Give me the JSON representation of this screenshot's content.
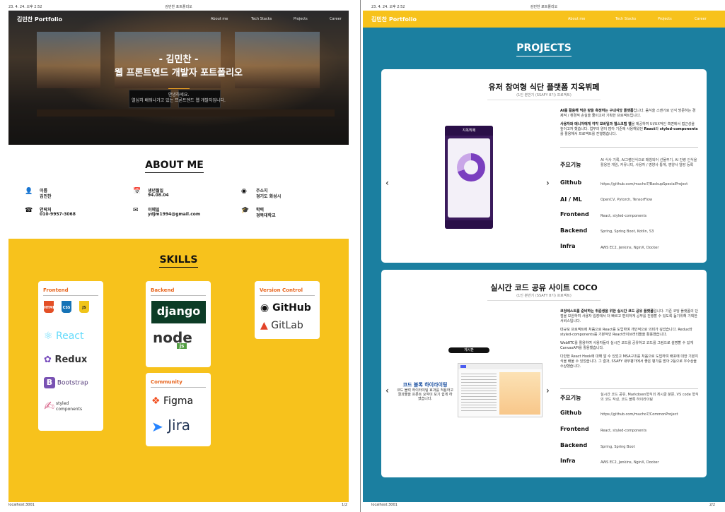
{
  "print": {
    "date": "23. 4. 24. 오후 2:52",
    "doc_title": "김민찬 포트폴리오",
    "url": "localhost:3001",
    "page1": "1/2",
    "page2": "2/2"
  },
  "nav": {
    "brand": "김민찬 Portfolio",
    "items": [
      "About me",
      "Tech Stacks",
      "Projects",
      "Career"
    ]
  },
  "hero": {
    "title_line1": "- 김민찬 -",
    "title_line2": "웹 프론트엔드 개발자 포트폴리오",
    "sub_line1": "안녕하세요.",
    "sub_line2": "열심히 배워나가고 있는 프론트엔드 웹 개발자입니다."
  },
  "about": {
    "title": "ABOUT ME",
    "items": [
      {
        "icon": "person-icon",
        "label": "이름",
        "value": "김민찬"
      },
      {
        "icon": "calendar-icon",
        "label": "생년월일",
        "value": "94.08.04"
      },
      {
        "icon": "location-icon",
        "label": "주소지",
        "value": "경기도 화성시"
      },
      {
        "icon": "phone-icon",
        "label": "연락처",
        "value": "010-9957-3068"
      },
      {
        "icon": "mail-icon",
        "label": "이메일",
        "value": "ydjm1994@gmail.com"
      },
      {
        "icon": "graduation-icon",
        "label": "학력",
        "value": "경북대학교"
      }
    ]
  },
  "skills": {
    "title": "SKILLS",
    "frontend": {
      "title": "Frontend",
      "logos": [
        "HTML",
        "CSS",
        "JS",
        "React",
        "Redux",
        "Bootstrap",
        "styled",
        "components"
      ]
    },
    "backend": {
      "title": "Backend",
      "logos": [
        "django",
        "node",
        "js"
      ]
    },
    "vcs": {
      "title": "Version Control",
      "logos": [
        "GitHub",
        "GitLab"
      ]
    },
    "community": {
      "title": "Community",
      "logos": [
        "Figma",
        "Jira"
      ]
    }
  },
  "projects": {
    "title": "PROJECTS",
    "p1": {
      "title": "유저 참여형 식단 플랫폼 지옥뷔페",
      "date": "(1인 분반기 (SSAFY 8기) 프로젝트)",
      "app_name": "지옥뷔페",
      "desc1_bold": "AI를 활용해 먹은 량을 측정하는 구내식당 플랫폼",
      "desc1": "입니다. 음식을 스캔기로 인식 방문하는 경제적 / 환경적 손실을 줄이고자 기획한 프로젝트입니다.",
      "desc2_bold": "사용자와 매니저에게 각각 모바일과 웹스크랩 웹",
      "desc2": "을 제공하여 UI/UX적인 측면에서 접근성을 높이고자 했습니다. 업무의 양이 많아 기준에 사용해왔던 ",
      "desc2_bold2": "React",
      "desc2b": "와 ",
      "desc2_bold3": "styled-components",
      "desc2c": "를 활용해서 프로젝트를 진행했습니다.",
      "rows": [
        {
          "k": "주요기능",
          "v": "AI 식사 기록, AI그램인식으로 매칭되어 선물주기, AI 잔량 인식을 활용한 게임, 커뮤니티, 사용자 / 영양사 통계, 영양사 알랑 등록"
        },
        {
          "k": "Github",
          "v": "https://github.com/mucho7/BackupSpecialProject"
        },
        {
          "k": "AI / ML",
          "v": "OpenCV, Pytorch, TensorFlow"
        },
        {
          "k": "Frontend",
          "v": "React, styled-components"
        },
        {
          "k": "Backend",
          "v": "Spring, Spring Boot, Kotlin, S3"
        },
        {
          "k": "Infra",
          "v": "AWS EC2, Jenkins, NginX, Docker"
        }
      ]
    },
    "p2": {
      "title": "실시간 코드 공유 사이트 COCO",
      "date": "(1인 분반기 (SSAFY 8기) 프로젝트)",
      "badge": "게시판",
      "caption_title": "코드 블록 하이라이팅",
      "caption": "코드 블럭 하이라이팅 효과를 적용하고 결과물을 프론트 요약이 보기 쉽게 하였습니다.",
      "desc1_bold": "코딩테스트를 준비하는 취준생을 위한 실시간 코드 공유 플랫폼",
      "desc1": "입니다. 기존 코딩 플랫폼의 단점을 보완하여 사용자 입장에서 더 빠르고 편리하게 공부를 진행할 수 있도록 돕기위해 기획한 서비스입니다.",
      "desc2": "대규모 프로젝트에 처음으로 React를 도입하며 개인적으로 의미가 깊었습니다. Redux와 styled-components를 기본적인 React라이브러리들을 활용했습니다.",
      "desc3": "WebRTC를 활용하여 사용자들이 실시간 코드를 공유하고 코드를 그림으로 설명할 수 있게 CanvasAPI를 활용했습니다.",
      "desc4": "다만한 React Hook에 대해 알 수 있었고 MSA구조를 처음으로 도입하며 배포에 대한 기본지식을 배울 수 있었습니다. 그 결과, SSAFY 내부평가에서 좋은 평가를 받아 2등으로 우수상을 수상했습니다.",
      "rows": [
        {
          "k": "주요기능",
          "v": "실시간 코드 공유, Markdown형식의 게시글 분문, VS code 형식의 코드 작성, 코드 블록 하이라이팅"
        },
        {
          "k": "Github",
          "v": "https://github.com/mucho7/CommonProject"
        },
        {
          "k": "Frontend",
          "v": "React, styled-components"
        },
        {
          "k": "Backend",
          "v": "Spring, Spring Boot"
        },
        {
          "k": "Infra",
          "v": "AWS EC2, Jenkins, NginX, Docker"
        }
      ]
    }
  },
  "colors": {
    "yellow": "#f7c21c",
    "teal": "#1b7fa0",
    "orange": "#e8651e"
  }
}
